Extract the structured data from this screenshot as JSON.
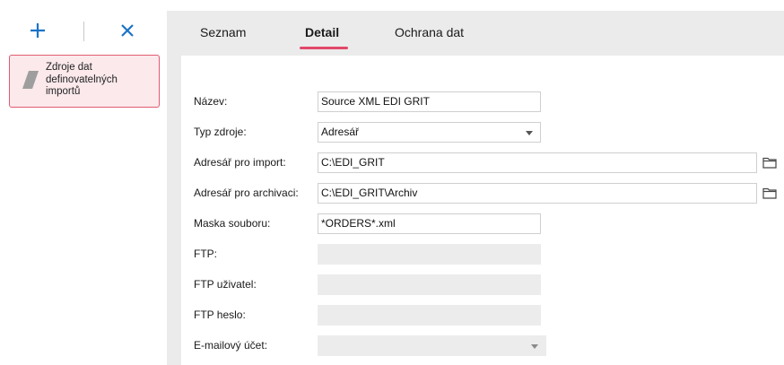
{
  "toolbar": {
    "add_icon": "plus-icon",
    "remove_icon": "close-icon",
    "accent_color": "#1a73c9"
  },
  "list": {
    "items": [
      {
        "label": "Zdroje dat definovatelných importů",
        "icon": "slash-parallelogram-icon",
        "selected": true
      }
    ],
    "selected_border": "#e05b70",
    "selected_bg": "#fbe9ec"
  },
  "tabs": {
    "items": [
      {
        "label": "Seznam",
        "active": false
      },
      {
        "label": "Detail",
        "active": true
      },
      {
        "label": "Ochrana dat",
        "active": false
      }
    ],
    "active_color": "#e2486a"
  },
  "form": {
    "nazev": {
      "label": "Název:",
      "value": "Source XML EDI GRIT"
    },
    "typ_zdroje": {
      "label": "Typ zdroje:",
      "value": "Adresář"
    },
    "adresar_import": {
      "label": "Adresář pro import:",
      "value": "C:\\EDI_GRIT",
      "icon": "folder-icon"
    },
    "adresar_archivace": {
      "label": "Adresář pro archivaci:",
      "value": "C:\\EDI_GRIT\\Archiv",
      "icon": "folder-icon"
    },
    "maska": {
      "label": "Maska souboru:",
      "value": "*ORDERS*.xml"
    },
    "ftp": {
      "label": "FTP:",
      "value": ""
    },
    "ftp_user": {
      "label": "FTP uživatel:",
      "value": ""
    },
    "ftp_pass": {
      "label": "FTP heslo:",
      "value": ""
    },
    "email": {
      "label": "E-mailový účet:",
      "value": ""
    }
  }
}
